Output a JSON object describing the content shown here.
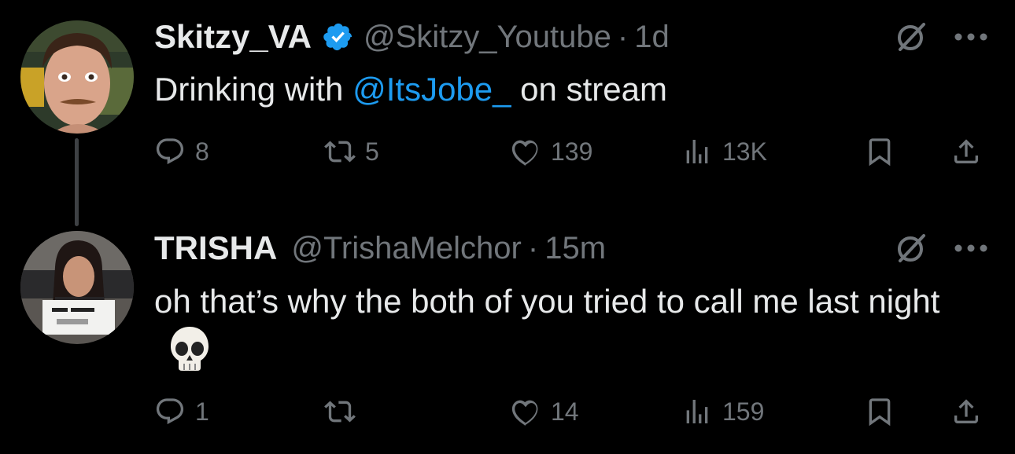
{
  "tweets": [
    {
      "display_name": "Skitzy_VA",
      "handle": "@Skitzy_Youtube",
      "separator": "·",
      "time": "1d",
      "text_before": "Drinking with ",
      "mention": "@ItsJobe_",
      "text_after": " on stream",
      "verified": true,
      "stats": {
        "replies": "8",
        "reposts": "5",
        "likes": "139",
        "views": "13K"
      }
    },
    {
      "display_name": "TRISHA",
      "handle": "@TrishaMelchor",
      "separator": "·",
      "time": "15m",
      "text": "oh that’s why the both of you tried to call me last night",
      "verified": false,
      "stats": {
        "replies": "1",
        "reposts": "",
        "likes": "14",
        "views": "159"
      }
    }
  ],
  "colors": {
    "background": "#000000",
    "text": "#e7e9ea",
    "muted": "#71767b",
    "accent": "#1d9bf0"
  },
  "icons": [
    "verified-badge-icon",
    "grok-icon",
    "more-icon",
    "reply-icon",
    "repost-icon",
    "like-icon",
    "views-icon",
    "bookmark-icon",
    "share-icon",
    "skull-emoji-icon"
  ]
}
